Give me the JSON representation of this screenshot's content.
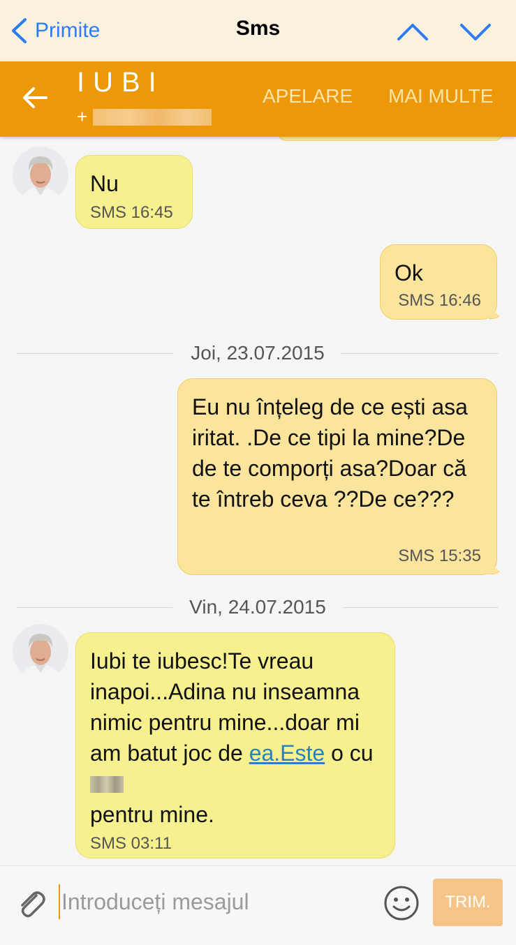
{
  "ios_nav": {
    "back_label": "Primite",
    "title": "Sms"
  },
  "header": {
    "contact_name": "IUBI",
    "contact_number_prefix": "+",
    "call_label": "APELARE",
    "more_label": "MAI MULTE",
    "accent_color": "#ed9809"
  },
  "conversation": {
    "messages": [
      {
        "direction": "incoming",
        "text": "Nu",
        "meta": "SMS 16:45"
      },
      {
        "direction": "outgoing",
        "text": "Ok",
        "meta": "SMS 16:46"
      },
      {
        "date": "Joi, 23.07.2015"
      },
      {
        "direction": "outgoing",
        "text": "Eu nu înțeleg de ce ești asa iritat. .De ce tipi la mine?De de te comporți asa?Doar că te întreb ceva ??De ce???",
        "meta": "SMS 15:35"
      },
      {
        "date": "Vin, 24.07.2015"
      },
      {
        "direction": "incoming",
        "text_before_link": "Iubi te iubesc!Te vreau inapoi...Adina nu inseamna nimic pentru mine...doar mi am batut joc de ",
        "link": "ea.Este",
        "text_after_link": " o cu",
        "text_end": "pentru mine.",
        "meta": "SMS 03:11"
      }
    ]
  },
  "compose": {
    "placeholder": "Introduceți mesajul",
    "send_label": "TRIM."
  },
  "icons": {
    "back": "chevron-left-icon",
    "prev": "chevron-up-icon",
    "next": "chevron-down-icon",
    "header_back": "arrow-left-icon",
    "attach": "paperclip-icon",
    "emoji": "smiley-icon"
  }
}
